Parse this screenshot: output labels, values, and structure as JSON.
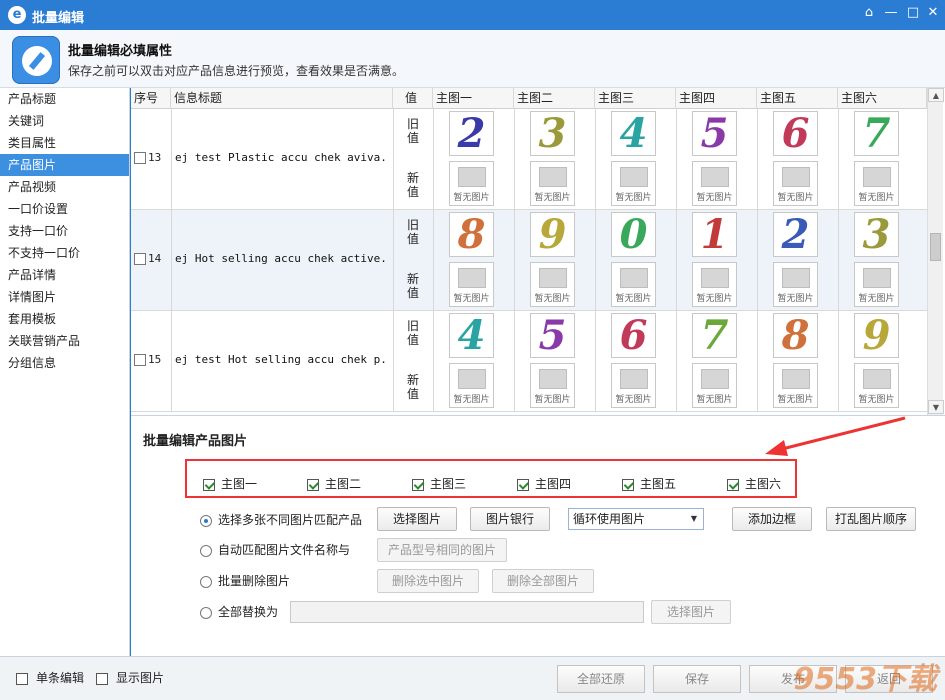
{
  "window": {
    "title": "批量编辑",
    "controls": [
      "⌂",
      "—",
      "□",
      "✕"
    ]
  },
  "header": {
    "title": "批量编辑必填属性",
    "description": "保存之前可以双击对应产品信息进行预览，查看效果是否满意。"
  },
  "sidebar": {
    "items": [
      {
        "label": "产品标题",
        "active": false
      },
      {
        "label": "关键词",
        "active": false
      },
      {
        "label": "类目属性",
        "active": false
      },
      {
        "label": "产品图片",
        "active": true
      },
      {
        "label": "产品视频",
        "active": false
      },
      {
        "label": "一口价设置",
        "active": false
      },
      {
        "label": "支持一口价",
        "active": false
      },
      {
        "label": "不支持一口价",
        "active": false
      },
      {
        "label": "产品详情",
        "active": false
      },
      {
        "label": "详情图片",
        "active": false
      },
      {
        "label": "套用模板",
        "active": false
      },
      {
        "label": "关联营销产品",
        "active": false
      },
      {
        "label": "分组信息",
        "active": false
      }
    ]
  },
  "table": {
    "headers": [
      "序号",
      "信息标题",
      "值",
      "主图一",
      "主图二",
      "主图三",
      "主图四",
      "主图五",
      "主图六"
    ],
    "old_label": "旧\n值",
    "new_label": "新\n值",
    "placeholder_text": "暂无图片",
    "rows": [
      {
        "no": "13",
        "title": "ej test Plastic accu chek aviva...",
        "old_images": [
          "2",
          "3",
          "4",
          "5",
          "6",
          "7"
        ],
        "colors": [
          "#3a3aa8",
          "#9a9a3a",
          "#2aa3a3",
          "#8a3aa8",
          "#c23a5a",
          "#3aa85a"
        ]
      },
      {
        "no": "14",
        "title": "ej Hot selling accu chek active...",
        "old_images": [
          "8",
          "9",
          "0",
          "1",
          "2",
          "3"
        ],
        "colors": [
          "#d0703a",
          "#b8a83a",
          "#3aa85a",
          "#c23a3a",
          "#3a5ab8",
          "#9a9a3a"
        ]
      },
      {
        "no": "15",
        "title": "ej test Hot selling accu chek p...",
        "old_images": [
          "4",
          "5",
          "6",
          "7",
          "8",
          "9"
        ],
        "colors": [
          "#2aa3a3",
          "#8a3aa8",
          "#c23a5a",
          "#6aa83a",
          "#d0703a",
          "#b8a83a"
        ]
      }
    ]
  },
  "bulk": {
    "section_title": "批量编辑产品图片",
    "checkboxes": [
      {
        "label": "主图一",
        "checked": true
      },
      {
        "label": "主图二",
        "checked": true
      },
      {
        "label": "主图三",
        "checked": true
      },
      {
        "label": "主图四",
        "checked": true
      },
      {
        "label": "主图五",
        "checked": true
      },
      {
        "label": "主图六",
        "checked": true
      }
    ],
    "option1": "选择多张不同图片匹配产品",
    "option2": "自动匹配图片文件名称与",
    "option3": "批量删除图片",
    "option4": "全部替换为",
    "btn_choose": "选择图片",
    "btn_bank": "图片银行",
    "select_value": "循环使用图片",
    "btn_border": "添加边框",
    "btn_shuffle": "打乱图片顺序",
    "btn_same_model": "产品型号相同的图片",
    "btn_del_selected": "删除选中图片",
    "btn_del_all": "删除全部图片",
    "btn_choose2": "选择图片"
  },
  "footer": {
    "single_edit": "单条编辑",
    "show_images": "显示图片",
    "restore_all": "全部还原",
    "save": "保存",
    "publish": "发布",
    "back": "返回"
  },
  "watermark": "9553下载"
}
